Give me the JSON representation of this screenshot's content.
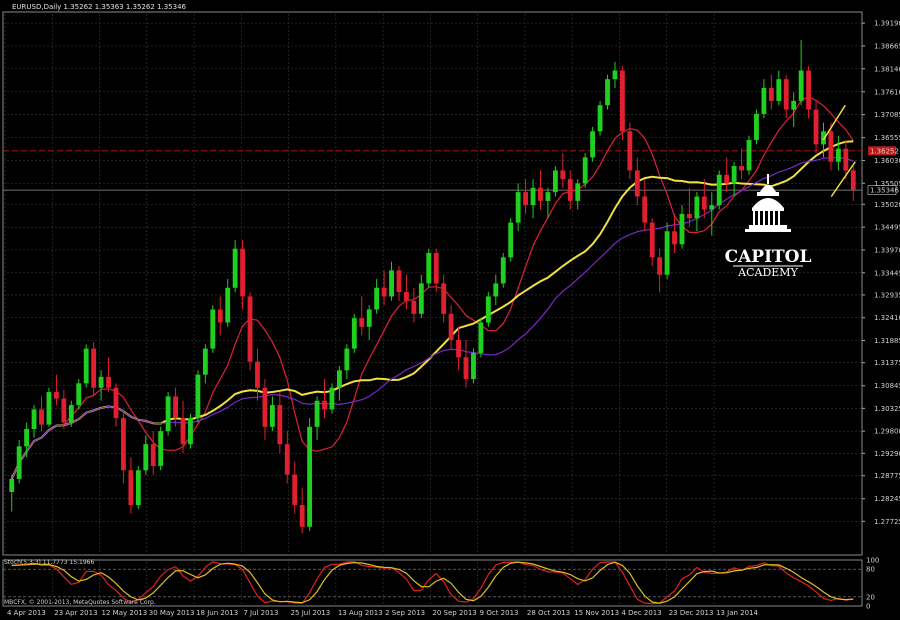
{
  "chart_data": {
    "type": "candlestick",
    "title": "EURUSD,Daily  1.35262 1.35363 1.35262 1.35346",
    "price_axis": {
      "ylim": [
        1.2695,
        1.394
      ],
      "ticks": [
        "1.39190",
        "1.38665",
        "1.38140",
        "1.37610",
        "1.37085",
        "1.36555",
        "1.36030",
        "1.35505",
        "1.35020",
        "1.34495",
        "1.33970",
        "1.33445",
        "1.32935",
        "1.32410",
        "1.31885",
        "1.31375",
        "1.30845",
        "1.30325",
        "1.29800",
        "1.29290",
        "1.28775",
        "1.28245",
        "1.27725"
      ],
      "current_price": "1.35346",
      "highlight_price": "1.36252"
    },
    "x_axis_labels": [
      "4 Apr 2013",
      "23 Apr 2013",
      "12 May 2013",
      "30 May 2013",
      "18 Jun 2013",
      "7 Jul 2013",
      "25 Jul 2013",
      "13 Aug 2013",
      "2 Sep 2013",
      "20 Sep 2013",
      "9 Oct 2013",
      "28 Oct 2013",
      "15 Nov 2013",
      "4 Dec 2013",
      "23 Dec 2013",
      "13 Jan 2014"
    ],
    "candles": [
      [
        1.284,
        1.288,
        1.2795,
        1.287
      ],
      [
        1.287,
        1.296,
        1.286,
        1.2945
      ],
      [
        1.2945,
        1.3,
        1.292,
        1.2985
      ],
      [
        1.2985,
        1.304,
        1.2965,
        1.303
      ],
      [
        1.303,
        1.306,
        1.298,
        1.2995
      ],
      [
        1.2995,
        1.308,
        1.299,
        1.307
      ],
      [
        1.307,
        1.311,
        1.304,
        1.3055
      ],
      [
        1.3055,
        1.3075,
        1.2985,
        1.3
      ],
      [
        1.3,
        1.305,
        1.299,
        1.304
      ],
      [
        1.304,
        1.31,
        1.303,
        1.309
      ],
      [
        1.309,
        1.318,
        1.308,
        1.317
      ],
      [
        1.317,
        1.3185,
        1.306,
        1.308
      ],
      [
        1.308,
        1.312,
        1.305,
        1.3105
      ],
      [
        1.3105,
        1.315,
        1.307,
        1.308
      ],
      [
        1.308,
        1.309,
        1.299,
        1.301
      ],
      [
        1.301,
        1.303,
        1.286,
        1.289
      ],
      [
        1.289,
        1.292,
        1.279,
        1.281
      ],
      [
        1.281,
        1.29,
        1.28,
        1.289
      ],
      [
        1.289,
        1.297,
        1.288,
        1.295
      ],
      [
        1.295,
        1.298,
        1.288,
        1.29
      ],
      [
        1.29,
        1.299,
        1.289,
        1.298
      ],
      [
        1.298,
        1.307,
        1.297,
        1.306
      ],
      [
        1.306,
        1.308,
        1.299,
        1.301
      ],
      [
        1.301,
        1.305,
        1.293,
        1.295
      ],
      [
        1.295,
        1.302,
        1.294,
        1.301
      ],
      [
        1.301,
        1.312,
        1.3,
        1.311
      ],
      [
        1.311,
        1.318,
        1.309,
        1.317
      ],
      [
        1.317,
        1.327,
        1.316,
        1.326
      ],
      [
        1.326,
        1.329,
        1.32,
        1.323
      ],
      [
        1.323,
        1.333,
        1.322,
        1.331
      ],
      [
        1.331,
        1.342,
        1.33,
        1.34
      ],
      [
        1.34,
        1.342,
        1.326,
        1.329
      ],
      [
        1.329,
        1.33,
        1.312,
        1.314
      ],
      [
        1.314,
        1.317,
        1.305,
        1.308
      ],
      [
        1.308,
        1.31,
        1.296,
        1.299
      ],
      [
        1.299,
        1.306,
        1.298,
        1.304
      ],
      [
        1.304,
        1.307,
        1.293,
        1.295
      ],
      [
        1.295,
        1.298,
        1.286,
        1.288
      ],
      [
        1.288,
        1.291,
        1.279,
        1.281
      ],
      [
        1.281,
        1.285,
        1.2745,
        1.276
      ],
      [
        1.276,
        1.301,
        1.275,
        1.299
      ],
      [
        1.299,
        1.306,
        1.296,
        1.305
      ],
      [
        1.305,
        1.31,
        1.301,
        1.303
      ],
      [
        1.303,
        1.309,
        1.302,
        1.308
      ],
      [
        1.308,
        1.313,
        1.305,
        1.312
      ],
      [
        1.312,
        1.318,
        1.31,
        1.317
      ],
      [
        1.317,
        1.325,
        1.316,
        1.324
      ],
      [
        1.324,
        1.329,
        1.32,
        1.322
      ],
      [
        1.322,
        1.327,
        1.319,
        1.326
      ],
      [
        1.326,
        1.333,
        1.325,
        1.331
      ],
      [
        1.331,
        1.335,
        1.327,
        1.329
      ],
      [
        1.329,
        1.337,
        1.328,
        1.335
      ],
      [
        1.335,
        1.336,
        1.328,
        1.33
      ],
      [
        1.33,
        1.334,
        1.326,
        1.328
      ],
      [
        1.328,
        1.331,
        1.323,
        1.325
      ],
      [
        1.325,
        1.334,
        1.324,
        1.332
      ],
      [
        1.332,
        1.34,
        1.331,
        1.339
      ],
      [
        1.339,
        1.34,
        1.33,
        1.332
      ],
      [
        1.332,
        1.334,
        1.323,
        1.325
      ],
      [
        1.325,
        1.327,
        1.317,
        1.319
      ],
      [
        1.319,
        1.322,
        1.312,
        1.315
      ],
      [
        1.315,
        1.319,
        1.308,
        1.31
      ],
      [
        1.31,
        1.317,
        1.309,
        1.316
      ],
      [
        1.316,
        1.324,
        1.315,
        1.323
      ],
      [
        1.323,
        1.33,
        1.322,
        1.329
      ],
      [
        1.329,
        1.334,
        1.327,
        1.332
      ],
      [
        1.332,
        1.339,
        1.331,
        1.338
      ],
      [
        1.338,
        1.347,
        1.337,
        1.346
      ],
      [
        1.346,
        1.355,
        1.344,
        1.353
      ],
      [
        1.353,
        1.356,
        1.348,
        1.35
      ],
      [
        1.35,
        1.356,
        1.347,
        1.354
      ],
      [
        1.354,
        1.358,
        1.349,
        1.351
      ],
      [
        1.351,
        1.354,
        1.347,
        1.353
      ],
      [
        1.353,
        1.359,
        1.352,
        1.358
      ],
      [
        1.358,
        1.362,
        1.354,
        1.356
      ],
      [
        1.356,
        1.358,
        1.349,
        1.351
      ],
      [
        1.351,
        1.356,
        1.349,
        1.355
      ],
      [
        1.355,
        1.362,
        1.354,
        1.361
      ],
      [
        1.361,
        1.368,
        1.36,
        1.367
      ],
      [
        1.367,
        1.374,
        1.366,
        1.373
      ],
      [
        1.373,
        1.38,
        1.372,
        1.379
      ],
      [
        1.379,
        1.383,
        1.377,
        1.381
      ],
      [
        1.381,
        1.382,
        1.365,
        1.367
      ],
      [
        1.367,
        1.369,
        1.356,
        1.358
      ],
      [
        1.358,
        1.361,
        1.35,
        1.352
      ],
      [
        1.352,
        1.356,
        1.344,
        1.346
      ],
      [
        1.346,
        1.347,
        1.336,
        1.338
      ],
      [
        1.338,
        1.34,
        1.33,
        1.334
      ],
      [
        1.334,
        1.346,
        1.333,
        1.344
      ],
      [
        1.344,
        1.348,
        1.339,
        1.341
      ],
      [
        1.341,
        1.35,
        1.34,
        1.348
      ],
      [
        1.348,
        1.354,
        1.345,
        1.347
      ],
      [
        1.347,
        1.353,
        1.344,
        1.352
      ],
      [
        1.352,
        1.356,
        1.347,
        1.349
      ],
      [
        1.349,
        1.353,
        1.343,
        1.35
      ],
      [
        1.35,
        1.358,
        1.349,
        1.357
      ],
      [
        1.357,
        1.361,
        1.353,
        1.355
      ],
      [
        1.355,
        1.36,
        1.352,
        1.359
      ],
      [
        1.359,
        1.363,
        1.356,
        1.358
      ],
      [
        1.358,
        1.366,
        1.357,
        1.365
      ],
      [
        1.365,
        1.372,
        1.364,
        1.371
      ],
      [
        1.371,
        1.379,
        1.37,
        1.377
      ],
      [
        1.377,
        1.38,
        1.372,
        1.374
      ],
      [
        1.374,
        1.381,
        1.373,
        1.379
      ],
      [
        1.379,
        1.38,
        1.37,
        1.372
      ],
      [
        1.372,
        1.376,
        1.368,
        1.374
      ],
      [
        1.374,
        1.388,
        1.373,
        1.381
      ],
      [
        1.381,
        1.382,
        1.37,
        1.372
      ],
      [
        1.372,
        1.374,
        1.362,
        1.364
      ],
      [
        1.364,
        1.369,
        1.361,
        1.367
      ],
      [
        1.367,
        1.369,
        1.358,
        1.36
      ],
      [
        1.36,
        1.366,
        1.358,
        1.363
      ],
      [
        1.363,
        1.365,
        1.356,
        1.358
      ],
      [
        1.358,
        1.359,
        1.351,
        1.3535
      ]
    ],
    "moving_averages": [
      {
        "color": "#e0203a",
        "period": 8
      },
      {
        "color": "#f0e040",
        "period": 21
      },
      {
        "color": "#7a28c8",
        "period": 34
      }
    ],
    "oscillator": {
      "label": "Stoch(5,3,3) 11.7773 15.1966",
      "levels": [
        "100",
        "80",
        "20",
        "0"
      ],
      "lines": [
        {
          "color": "#e02020"
        },
        {
          "color": "#e0c020"
        }
      ]
    },
    "copyright": "MBCFX, © 2001-2013, MetaQuotes Software Corp."
  },
  "logo": {
    "line1": "CAPITOL",
    "line2": "ACADEMY"
  },
  "colors": {
    "bull": "#20d020",
    "bear": "#e02030",
    "grid": "#3a3a3a",
    "annotation": "#f0e040"
  }
}
